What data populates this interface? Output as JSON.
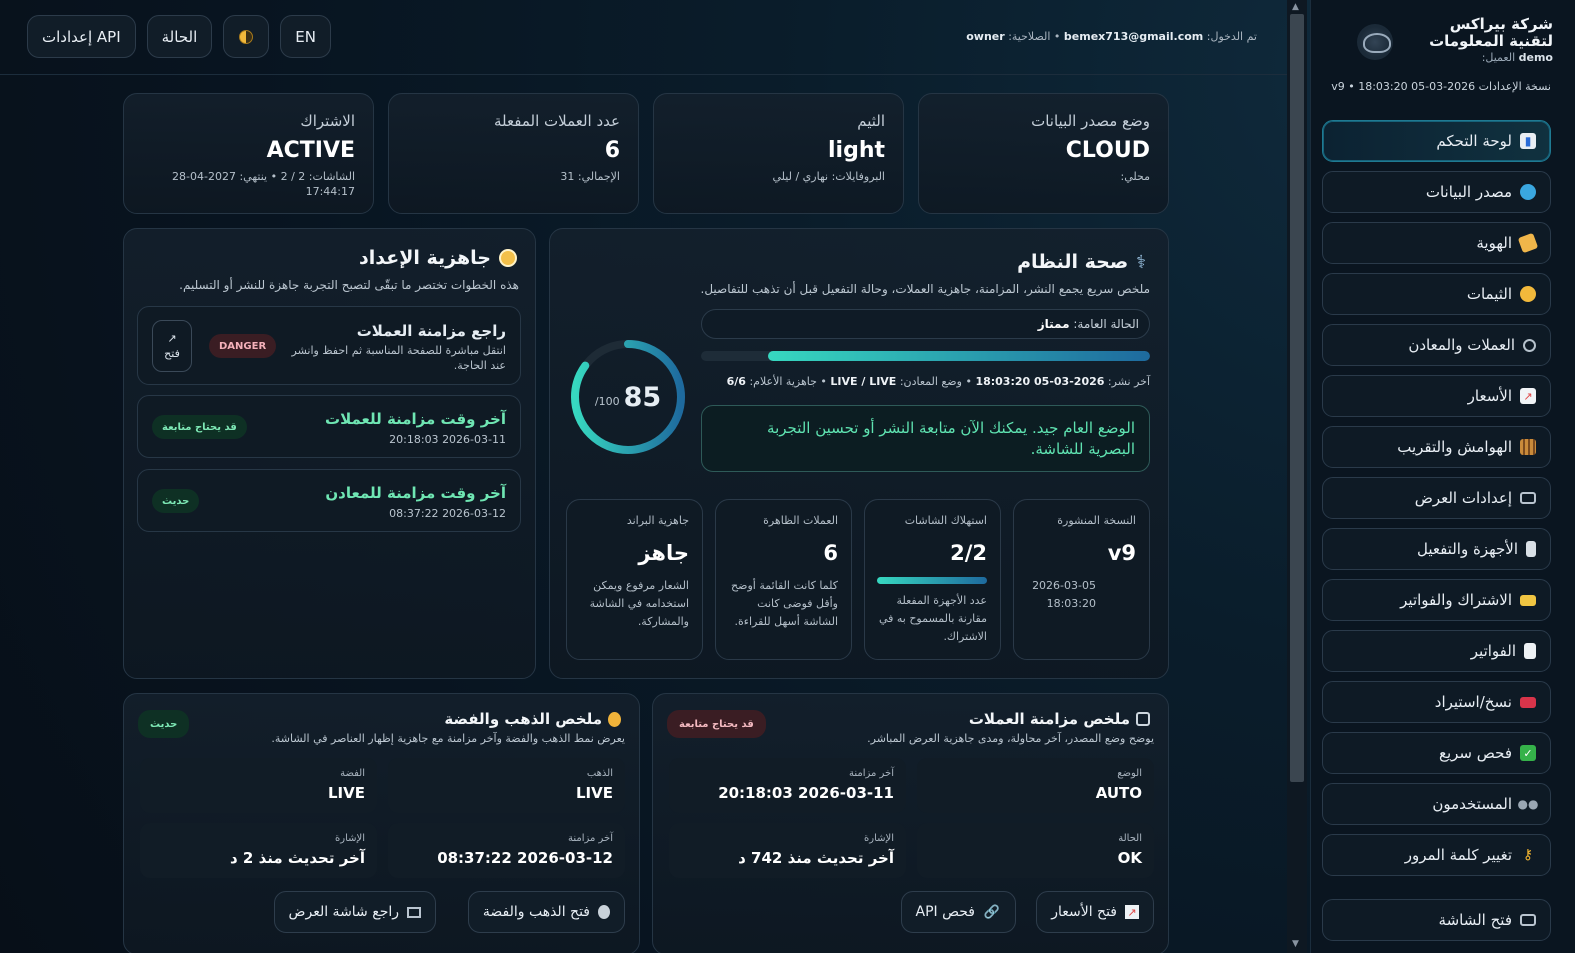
{
  "sidebar": {
    "company": "شركة بيراكس لتقنية المعلومات",
    "client_label": "العميل:",
    "client_value": "demo",
    "version_line": "نسخة الإعدادات 2026-03-05 18:03:20 • v9",
    "items": [
      {
        "label": "لوحة التحكم",
        "icon": "chart-icon"
      },
      {
        "label": "مصدر البيانات",
        "icon": "globe-icon"
      },
      {
        "label": "الهوية",
        "icon": "tag-icon"
      },
      {
        "label": "الثيمات",
        "icon": "palette-icon"
      },
      {
        "label": "العملات والمعادن",
        "icon": "sync-icon"
      },
      {
        "label": "الأسعار",
        "icon": "trend-icon"
      },
      {
        "label": "الهوامش والتقريب",
        "icon": "abacus-icon"
      },
      {
        "label": "إعدادات العرض",
        "icon": "monitor-icon"
      },
      {
        "label": "الأجهزة والتفعيل",
        "icon": "phone-icon"
      },
      {
        "label": "الاشتراك والفواتير",
        "icon": "card-icon"
      },
      {
        "label": "الفواتير",
        "icon": "document-icon"
      },
      {
        "label": "نسخ/استيراد",
        "icon": "toolbox-icon"
      },
      {
        "label": "فحص سريع",
        "icon": "check-icon"
      },
      {
        "label": "المستخدمون",
        "icon": "users-icon"
      },
      {
        "label": "تغيير كلمة المرور",
        "icon": "key-icon"
      }
    ],
    "bottom_item": {
      "label": "فتح الشاشة",
      "icon": "monitor-icon"
    }
  },
  "topbar": {
    "buttons": {
      "api": "إعدادات API",
      "status": "الحالة",
      "theme_icon": "half-moon-icon",
      "lang": "EN"
    },
    "login_prefix": "تم الدخول:",
    "email": "bemex713@gmail.com",
    "role_label": "الصلاحية:",
    "role": "owner"
  },
  "stats": [
    {
      "label": "وضع مصدر البيانات",
      "value": "CLOUD",
      "sub": "محلي:"
    },
    {
      "label": "الثيم",
      "value": "light",
      "sub": "البروفايلات: نهاري / ليلي"
    },
    {
      "label": "عدد العملات المفعلة",
      "value": "6",
      "sub": "الإجمالي: 31"
    },
    {
      "label": "الاشتراك",
      "value": "ACTIVE",
      "sub": "الشاشات: 2 / 2 • ينتهي: 2027-04-28 17:44:17"
    }
  ],
  "health": {
    "title": "صحة النظام",
    "subtitle": "ملخص سريع يجمع النشر، المزامنة، جاهزية العملات، وحالة التفعيل قبل أن تذهب للتفاصيل.",
    "overall_label": "الحالة العامة:",
    "overall_value": "ممتاز",
    "score": 85,
    "score_max": "/100",
    "progress": 0.85,
    "pub_label": "آخر نشر:",
    "pub_value": "2026-03-05 18:03:20",
    "metals_label": "وضع المعادن:",
    "metals_value": "LIVE / LIVE",
    "flags_label": "جاهزية الأعلام:",
    "flags_value": "6/6",
    "message": "الوضع العام جيد. يمكنك الآن متابعة النشر أو تحسين التجربة البصرية للشاشة.",
    "cards": [
      {
        "label": "النسخة المنشورة",
        "value": "v9",
        "desc": "2026-03-05 18:03:20"
      },
      {
        "label": "استهلاك الشاشات",
        "value": "2/2",
        "desc": "عدد الأجهزة المفعلة مقارنة بالمسموح به في الاشتراك.",
        "fill": 1.0
      },
      {
        "label": "العملات الظاهرة",
        "value": "6",
        "desc": "كلما كانت القائمة أوضح وأقل فوضى كانت الشاشة أسهل للقراءة."
      },
      {
        "label": "جاهزية البراند",
        "value": "جاهز",
        "desc": "الشعار مرفوع ويمكن استخدامه في الشاشة والمشاركة."
      }
    ]
  },
  "readiness": {
    "title": "جاهزية الإعداد",
    "subtitle": "هذه الخطوات تختصر ما تبقّى لتصبح التجربة جاهزة للنشر أو التسليم.",
    "items": [
      {
        "title": "راجع مزامنة العملات",
        "desc": "انتقل مباشرة للصفحة المناسبة ثم احفظ وانشر عند الحاجة.",
        "badge": "DANGER",
        "open": "فتح",
        "open_icon": "arrow-up-right-icon"
      },
      {
        "title": "آخر وقت مزامنة للعملات",
        "desc": "2026-03-11 20:18:03",
        "badge": "قد يحتاج متابعة"
      },
      {
        "title": "آخر وقت مزامنة للمعادن",
        "desc": "2026-03-12 08:37:22",
        "badge": "حديث"
      }
    ]
  },
  "currency_sync": {
    "title": "ملخص مزامنة العملات",
    "subtitle": "يوضح وضع المصدر، آخر محاولة، ومدى جاهزية العرض المباشر.",
    "badge": "قد يحتاج متابعة",
    "cells": [
      {
        "label": "الوضع",
        "value": "AUTO"
      },
      {
        "label": "آخر مزامنة",
        "value": "2026-03-11 20:18:03"
      },
      {
        "label": "الحالة",
        "value": "OK"
      },
      {
        "label": "الإشارة",
        "value": "آخر تحديث منذ 742 د"
      }
    ],
    "buttons": [
      {
        "label": "فتح الأسعار",
        "icon": "trend-icon"
      },
      {
        "label": "فحص API",
        "icon": "link-icon"
      }
    ]
  },
  "metals": {
    "title": "ملخص الذهب والفضة",
    "subtitle": "يعرض نمط الذهب والفضة وآخر مزامنة مع جاهزية إظهار العناصر في الشاشة.",
    "badge": "حديث",
    "cells": [
      {
        "label": "الذهب",
        "value": "LIVE"
      },
      {
        "label": "الفضة",
        "value": "LIVE"
      },
      {
        "label": "آخر مزامنة",
        "value": "2026-03-12 08:37:22"
      },
      {
        "label": "الإشارة",
        "value": "آخر تحديث منذ 2 د"
      }
    ],
    "buttons": [
      {
        "label": "فتح الذهب والفضة",
        "icon": "medal-icon"
      },
      {
        "label": "راجع شاشة العرض",
        "icon": "monitor-icon"
      }
    ]
  }
}
